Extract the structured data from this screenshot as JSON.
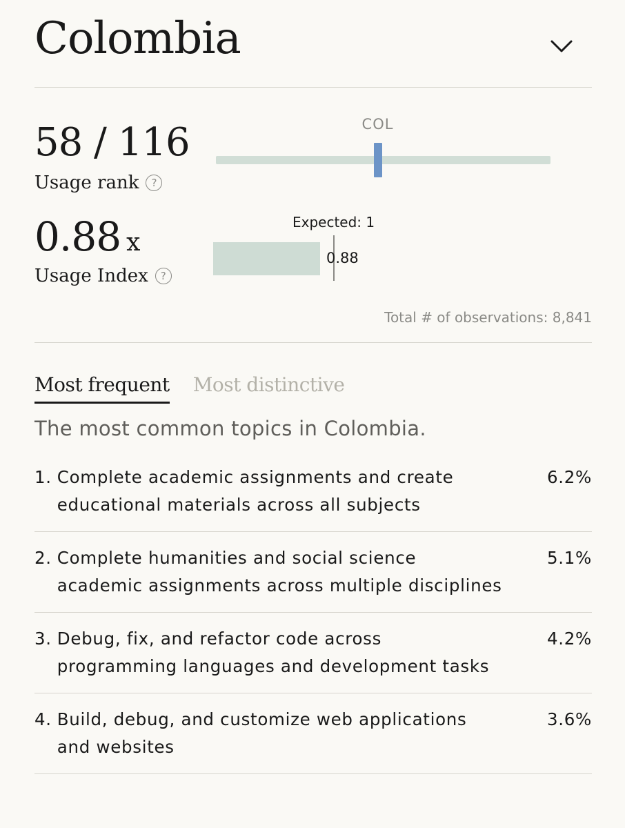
{
  "header": {
    "country": "Colombia"
  },
  "rank": {
    "value": "58 / 116",
    "label": "Usage rank",
    "position": 58,
    "total": 116,
    "code": "COL"
  },
  "index": {
    "value": "0.88",
    "suffix": "x",
    "label": "Usage Index",
    "expected_label": "Expected: 1",
    "bar_value": "0.88",
    "value_num": 0.88,
    "expected_num": 1
  },
  "observations": "Total # of observations: 8,841",
  "tabs": [
    {
      "label": "Most frequent",
      "active": true
    },
    {
      "label": "Most distinctive",
      "active": false
    }
  ],
  "section_description": "The most common topics in Colombia.",
  "topics": [
    {
      "num": "1.",
      "text": "Complete academic assignments and create educational materials across all subjects",
      "pct": "6.2%"
    },
    {
      "num": "2.",
      "text": "Complete humanities and social science academic assignments across multiple disciplines",
      "pct": "5.1%"
    },
    {
      "num": "3.",
      "text": "Debug, fix, and refactor code across programming languages and development tasks",
      "pct": "4.2%"
    },
    {
      "num": "4.",
      "text": "Build, debug, and customize web applications and websites",
      "pct": "3.6%"
    }
  ],
  "colors": {
    "background": "#faf9f5",
    "rank_track": "#d1ded6",
    "rank_marker": "#6c94c7",
    "index_bar": "#cedcd4",
    "muted_text": "#8a8a86"
  },
  "icons": {
    "collapse": "chevron-down-icon",
    "help": "help-circle-icon"
  }
}
